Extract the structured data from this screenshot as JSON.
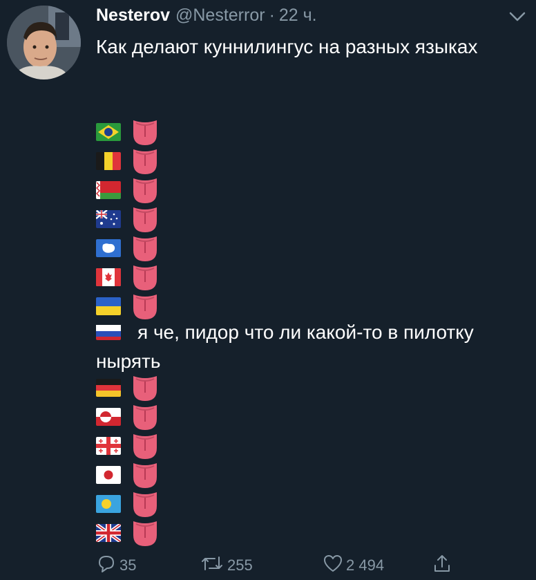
{
  "tweet": {
    "author_name": "Nesterov",
    "handle": "@Nesterror",
    "separator": "·",
    "time": "22 ч.",
    "text": "Как делают куннилингус на разных языках",
    "russia_text": "я че, пидор что ли какой-то в пилотку нырять"
  },
  "flag_rows_top": [
    {
      "flag": "brazil-flag"
    },
    {
      "flag": "belgium-flag"
    },
    {
      "flag": "belarus-flag"
    },
    {
      "flag": "australia-flag"
    },
    {
      "flag": "antarctica-flag"
    },
    {
      "flag": "canada-flag"
    },
    {
      "flag": "ukraine-flag"
    }
  ],
  "flag_rows_bottom": [
    {
      "flag": "germany-flag"
    },
    {
      "flag": "greenland-flag"
    },
    {
      "flag": "georgia-flag"
    },
    {
      "flag": "japan-flag"
    },
    {
      "flag": "palau-flag"
    },
    {
      "flag": "uk-flag"
    }
  ],
  "actions": {
    "replies": "35",
    "retweets": "255",
    "likes": "2 494"
  },
  "colors": {
    "background": "#15202b",
    "text": "#ffffff",
    "muted": "#8899a6",
    "tongue": "#e8607a"
  }
}
